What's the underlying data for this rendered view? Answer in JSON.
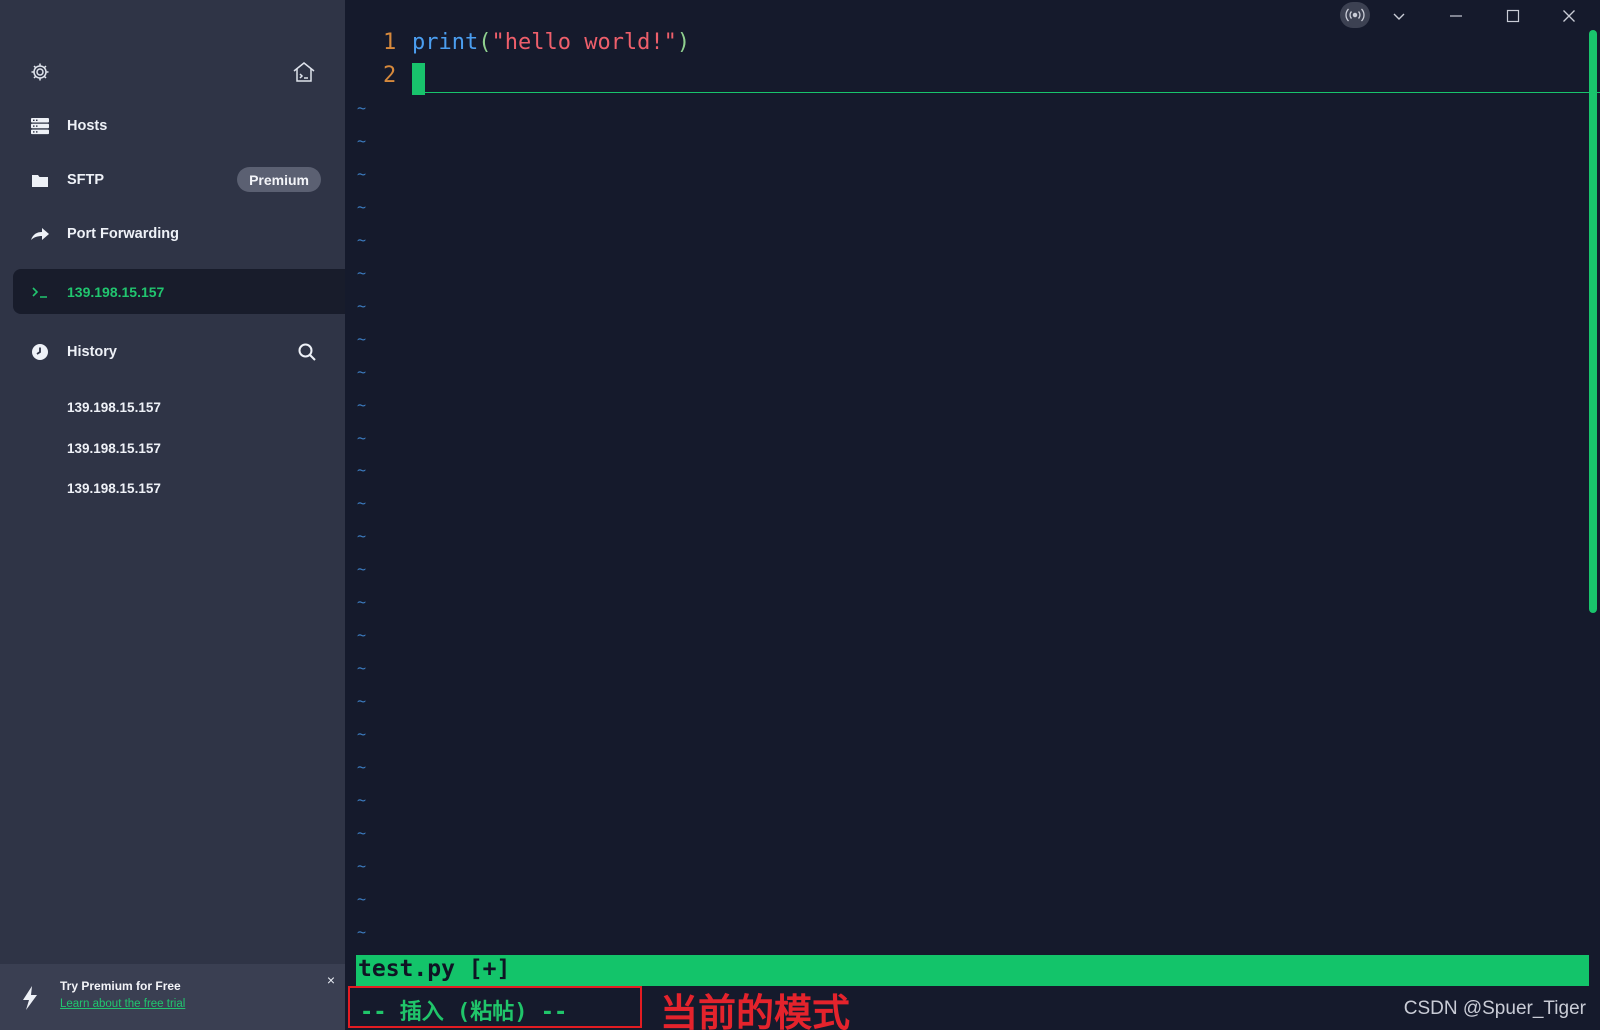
{
  "sidebar": {
    "nav": {
      "hosts": "Hosts",
      "sftp": "SFTP",
      "sftp_badge": "Premium",
      "port_forwarding": "Port Forwarding"
    },
    "active_session": "139.198.15.157",
    "history": {
      "label": "History",
      "entries": [
        "139.198.15.157",
        "139.198.15.157",
        "139.198.15.157"
      ]
    },
    "promo": {
      "title": "Try Premium for Free",
      "link": "Learn about the free trial",
      "close": "×"
    }
  },
  "editor": {
    "line_numbers": [
      "1",
      "2"
    ],
    "line1": {
      "func": "print",
      "open_paren": "(",
      "string": "\"hello world!\"",
      "close_paren": ")"
    },
    "tilde": "~",
    "status_line": "test.py [+]",
    "mode": "-- 插入 (粘帖) --"
  },
  "annotation": "当前的模式",
  "watermark": "CSDN @Spuer_Tiger",
  "colors": {
    "sidebar_bg": "#2f3446",
    "terminal_bg": "#151a2c",
    "accent_green": "#18c36c",
    "annotation_red": "#e31c22"
  }
}
